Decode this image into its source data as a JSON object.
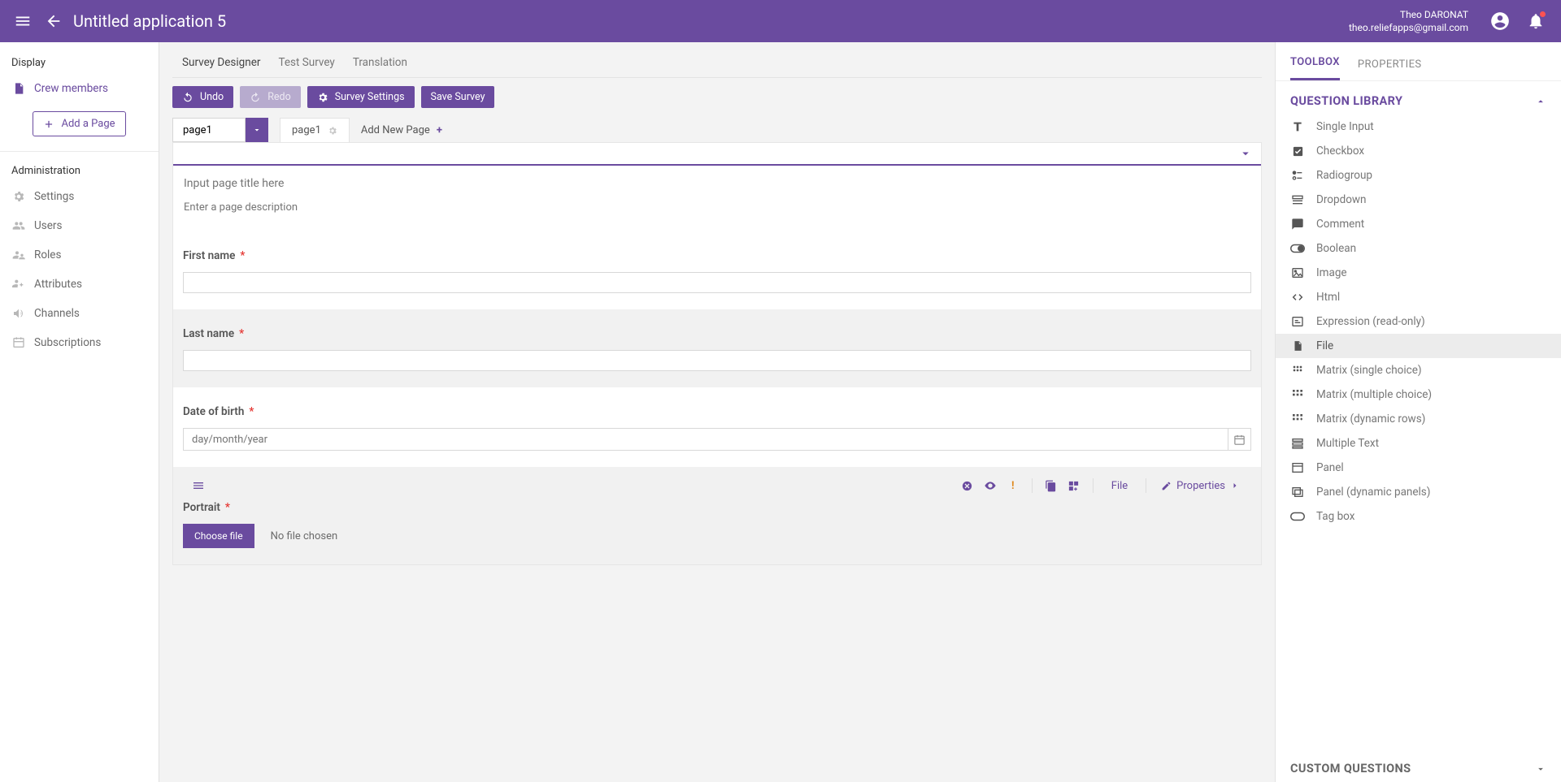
{
  "header": {
    "title": "Untitled application 5",
    "user_name": "Theo DARONAT",
    "user_email": "theo.reliefapps@gmail.com"
  },
  "sidebar": {
    "display_label": "Display",
    "page_item": "Crew members",
    "add_page": "Add a Page",
    "admin_label": "Administration",
    "admin_items": [
      {
        "label": "Settings"
      },
      {
        "label": "Users"
      },
      {
        "label": "Roles"
      },
      {
        "label": "Attributes"
      },
      {
        "label": "Channels"
      },
      {
        "label": "Subscriptions"
      }
    ]
  },
  "top_tabs": {
    "t1": "Survey Designer",
    "t2": "Test Survey",
    "t3": "Translation"
  },
  "toolbar": {
    "undo": "Undo",
    "redo": "Redo",
    "settings": "Survey Settings",
    "save": "Save Survey"
  },
  "pagebar": {
    "current": "page1",
    "tab_label": "page1",
    "add_new": "Add New Page"
  },
  "page_fields": {
    "title_ph": "Input page title here",
    "desc_ph": "Enter a page description"
  },
  "questions": {
    "q1_label": "First name",
    "q2_label": "Last name",
    "q3_label": "Date of birth",
    "q3_placeholder": "day/month/year",
    "q4_label": "Portrait",
    "choose_file": "Choose file",
    "no_file": "No file chosen",
    "sel_type": "File",
    "sel_props": "Properties"
  },
  "right": {
    "tab_toolbox": "TOOLBOX",
    "tab_properties": "PROPERTIES",
    "section_library": "QUESTION LIBRARY",
    "section_custom": "CUSTOM QUESTIONS",
    "items": [
      "Single Input",
      "Checkbox",
      "Radiogroup",
      "Dropdown",
      "Comment",
      "Boolean",
      "Image",
      "Html",
      "Expression (read-only)",
      "File",
      "Matrix (single choice)",
      "Matrix (multiple choice)",
      "Matrix (dynamic rows)",
      "Multiple Text",
      "Panel",
      "Panel (dynamic panels)",
      "Tag box"
    ]
  }
}
